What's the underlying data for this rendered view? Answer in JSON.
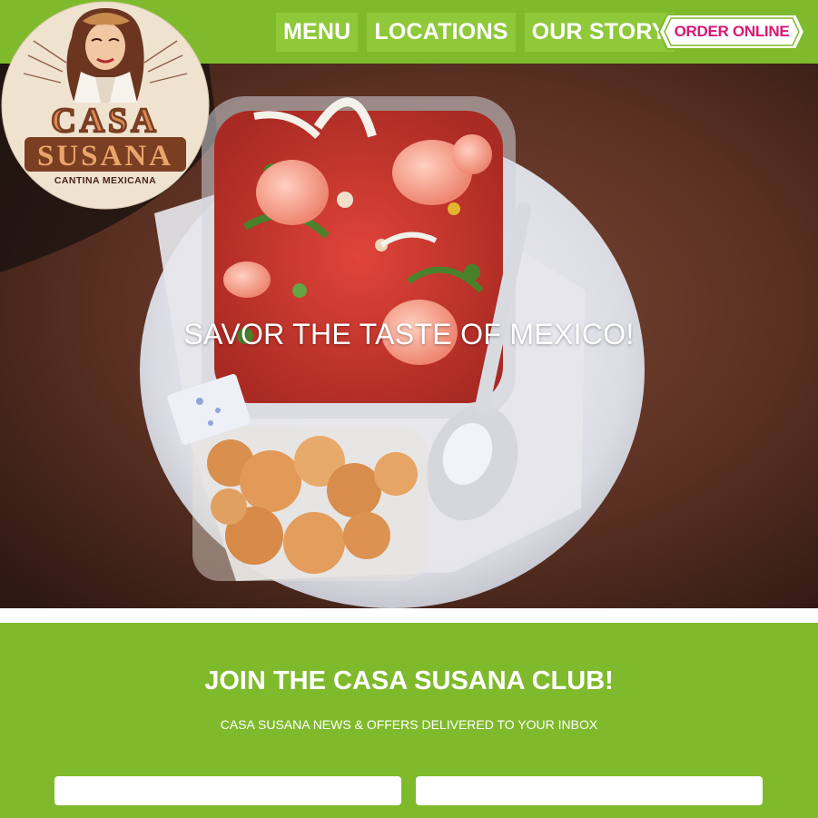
{
  "nav": {
    "items": [
      {
        "label": "MENU"
      },
      {
        "label": "LOCATIONS"
      },
      {
        "label": "OUR STORY"
      }
    ],
    "order_label": "ORDER ONLINE"
  },
  "logo": {
    "name_top": "CASA",
    "name_bottom": "SUSANA",
    "tagline": "CANTINA MEXICANA"
  },
  "hero": {
    "headline": "SAVOR THE TASTE OF MEXICO!"
  },
  "club": {
    "title": "JOIN THE CASA SUSANA CLUB!",
    "subtitle": "CASA SUSANA NEWS & OFFERS DELIVERED TO YOUR INBOX",
    "field_1_value": "",
    "field_2_value": ""
  },
  "colors": {
    "brand_green": "#7fba2c",
    "nav_button": "#8fc93a",
    "order_pink": "#d81873",
    "logo_brown": "#7a3e22"
  }
}
